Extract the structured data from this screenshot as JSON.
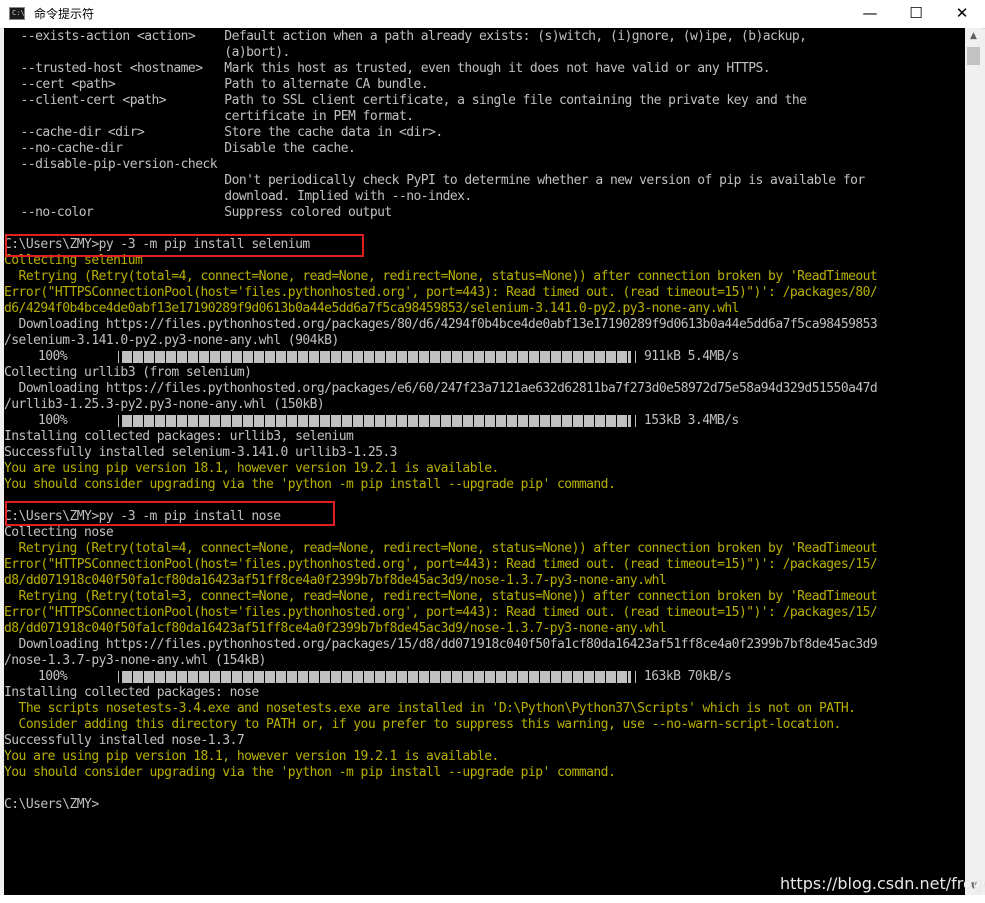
{
  "window": {
    "title": "命令提示符",
    "icon_text": "C:\\",
    "controls": {
      "minimize": "—",
      "maximize": "☐",
      "close": "✕"
    },
    "colors": {
      "console_bg": "#000000",
      "text": "#c0c0c0",
      "warning": "#b8b000",
      "highlight": "#e0201f"
    }
  },
  "lines": [
    "  --exists-action <action>    Default action when a path already exists: (s)witch, (i)gnore, (w)ipe, (b)ackup,",
    "                              (a)bort).",
    "  --trusted-host <hostname>   Mark this host as trusted, even though it does not have valid or any HTTPS.",
    "  --cert <path>               Path to alternate CA bundle.",
    "  --client-cert <path>        Path to SSL client certificate, a single file containing the private key and the",
    "                              certificate in PEM format.",
    "  --cache-dir <dir>           Store the cache data in <dir>.",
    "  --no-cache-dir              Disable the cache.",
    "  --disable-pip-version-check",
    "                              Don't periodically check PyPI to determine whether a new version of pip is available for",
    "                              download. Implied with --no-index.",
    "  --no-color                  Suppress colored output",
    "",
    "C:\\Users\\ZMY>py -3 -m pip install selenium",
    "Collecting selenium",
    "  Retrying (Retry(total=4, connect=None, read=None, redirect=None, status=None)) after connection broken by 'ReadTimeout",
    "Error(\"HTTPSConnectionPool(host='files.pythonhosted.org', port=443): Read timed out. (read timeout=15)\")': /packages/80/",
    "d6/4294f0b4bce4de0abf13e17190289f9d0613b0a44e5dd6a7f5ca98459853/selenium-3.141.0-py2.py3-none-any.whl",
    "  Downloading https://files.pythonhosted.org/packages/80/d6/4294f0b4bce4de0abf13e17190289f9d0613b0a44e5dd6a7f5ca98459853",
    "/selenium-3.141.0-py2.py3-none-any.whl (904kB)",
    "",
    "Collecting urllib3 (from selenium)",
    "  Downloading https://files.pythonhosted.org/packages/e6/60/247f23a7121ae632d62811ba7f273d0e58972d75e58a94d329d51550a47d",
    "/urllib3-1.25.3-py2.py3-none-any.whl (150kB)",
    "",
    "Installing collected packages: urllib3, selenium",
    "Successfully installed selenium-3.141.0 urllib3-1.25.3",
    "You are using pip version 18.1, however version 19.2.1 is available.",
    "You should consider upgrading via the 'python -m pip install --upgrade pip' command.",
    "",
    "C:\\Users\\ZMY>py -3 -m pip install nose",
    "Collecting nose",
    "  Retrying (Retry(total=4, connect=None, read=None, redirect=None, status=None)) after connection broken by 'ReadTimeout",
    "Error(\"HTTPSConnectionPool(host='files.pythonhosted.org', port=443): Read timed out. (read timeout=15)\")': /packages/15/",
    "d8/dd071918c040f50fa1cf80da16423af51ff8ce4a0f2399b7bf8de45ac3d9/nose-1.3.7-py3-none-any.whl",
    "  Retrying (Retry(total=3, connect=None, read=None, redirect=None, status=None)) after connection broken by 'ReadTimeout",
    "Error(\"HTTPSConnectionPool(host='files.pythonhosted.org', port=443): Read timed out. (read timeout=15)\")': /packages/15/",
    "d8/dd071918c040f50fa1cf80da16423af51ff8ce4a0f2399b7bf8de45ac3d9/nose-1.3.7-py3-none-any.whl",
    "  Downloading https://files.pythonhosted.org/packages/15/d8/dd071918c040f50fa1cf80da16423af51ff8ce4a0f2399b7bf8de45ac3d9",
    "/nose-1.3.7-py3-none-any.whl (154kB)",
    "",
    "Installing collected packages: nose",
    "  The scripts nosetests-3.4.exe and nosetests.exe are installed in 'D:\\Python\\Python37\\Scripts' which is not on PATH.",
    "  Consider adding this directory to PATH or, if you prefer to suppress this warning, use --no-warn-script-location.",
    "Successfully installed nose-1.3.7",
    "You are using pip version 18.1, however version 19.2.1 is available.",
    "You should consider upgrading via the 'python -m pip install --upgrade pip' command.",
    "",
    "C:\\Users\\ZMY>"
  ],
  "progress": [
    {
      "percent": "100%",
      "fraction": 1.0,
      "speed": "911kB 5.4MB/s"
    },
    {
      "percent": "100%",
      "fraction": 1.0,
      "speed": "153kB 3.4MB/s"
    },
    {
      "percent": "100%",
      "fraction": 1.0,
      "speed": "163kB 70kB/s"
    }
  ],
  "watermark": "https://blog.csdn.net/frogca"
}
